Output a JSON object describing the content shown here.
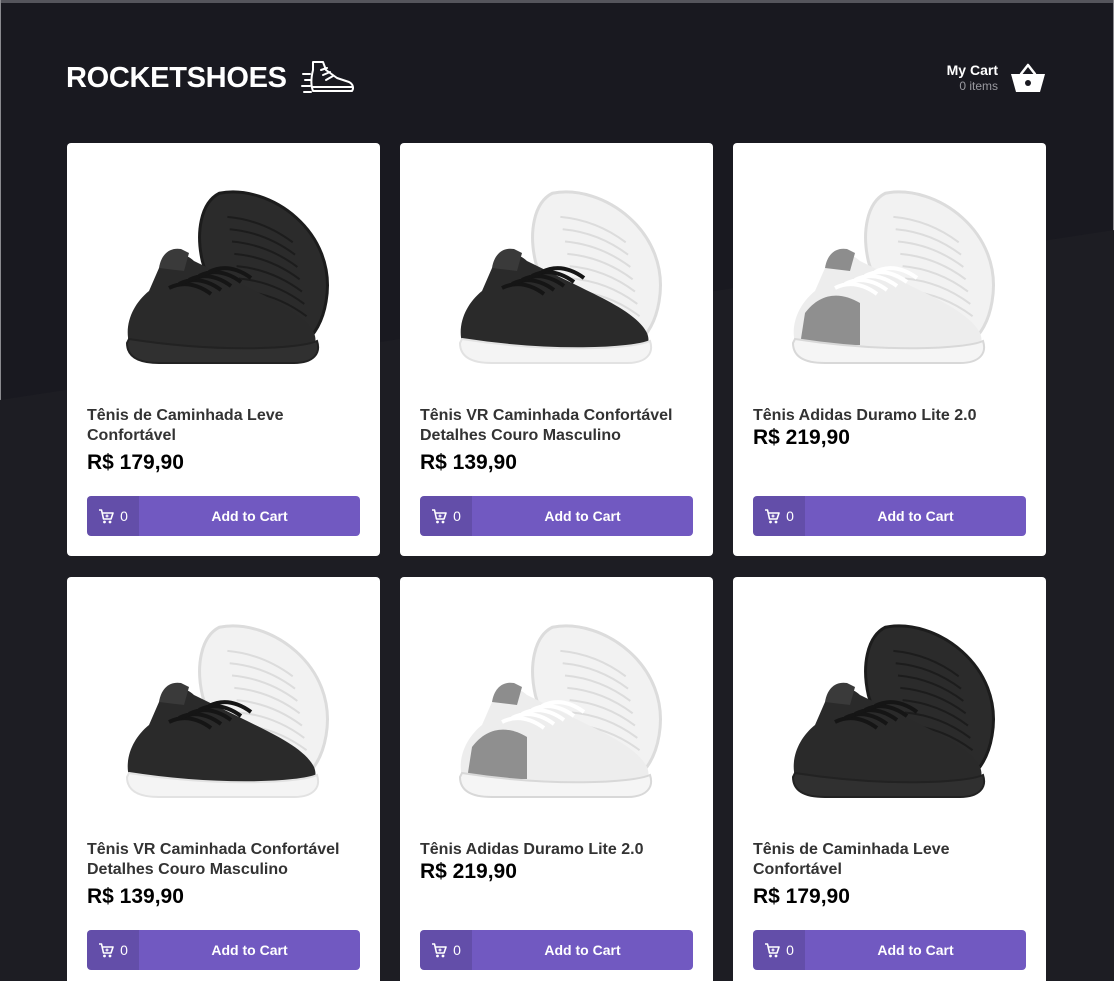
{
  "header": {
    "logo_text": "ROCKETSHOES",
    "cart_title": "My Cart",
    "cart_count": "0 items"
  },
  "colors": {
    "background": "#191920",
    "accent": "#7159c1",
    "card": "#ffffff"
  },
  "products": [
    {
      "title": "Tênis de Caminhada Leve Confortável",
      "price": "R$ 179,90",
      "count": "0",
      "button": "Add to Cart",
      "shoe": "black-sole-black"
    },
    {
      "title": "Tênis VR Caminhada Confortável Detalhes Couro Masculino",
      "price": "R$ 139,90",
      "count": "0",
      "button": "Add to Cart",
      "shoe": "black-sole-white"
    },
    {
      "title": "Tênis Adidas Duramo Lite 2.0",
      "price": "R$ 219,90",
      "count": "0",
      "button": "Add to Cart",
      "shoe": "white-gray"
    },
    {
      "title": "Tênis VR Caminhada Confortável Detalhes Couro Masculino",
      "price": "R$ 139,90",
      "count": "0",
      "button": "Add to Cart",
      "shoe": "black-sole-white"
    },
    {
      "title": "Tênis Adidas Duramo Lite 2.0",
      "price": "R$ 219,90",
      "count": "0",
      "button": "Add to Cart",
      "shoe": "white-gray"
    },
    {
      "title": "Tênis de Caminhada Leve Confortável",
      "price": "R$ 179,90",
      "count": "0",
      "button": "Add to Cart",
      "shoe": "black-sole-black"
    }
  ]
}
